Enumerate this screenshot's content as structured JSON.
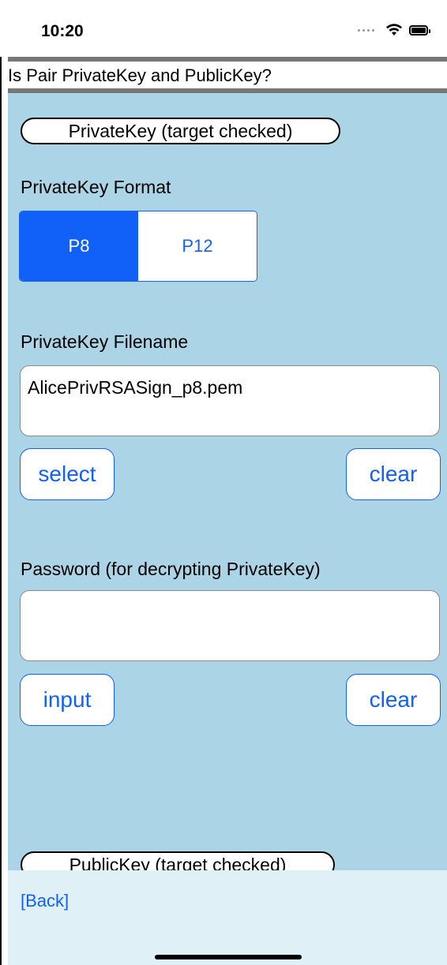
{
  "status_bar": {
    "time": "10:20",
    "icons": [
      "signal-dots-icon",
      "wifi-icon",
      "battery-icon"
    ]
  },
  "title": "Is Pair PrivateKey and PublicKey?",
  "private_key_section": {
    "header_pill": "PrivateKey (target checked)",
    "format_label": "PrivateKey Format",
    "format_options": [
      "P8",
      "P12"
    ],
    "format_selected": "P8",
    "filename_label": "PrivateKey Filename",
    "filename_value": "AlicePrivRSASign_p8.pem",
    "select_button": "select",
    "filename_clear_button": "clear",
    "password_label": "Password (for decrypting PrivateKey)",
    "password_value": "",
    "input_button": "input",
    "password_clear_button": "clear"
  },
  "public_key_section": {
    "header_pill": "PublicKey (target checked)"
  },
  "bottom_bar": {
    "back_link": "[Back]"
  },
  "colors": {
    "content_background": "#abd4e7",
    "accent": "#1160f7",
    "bottom_bar_background": "#dff0f7",
    "rule": "#777777"
  }
}
